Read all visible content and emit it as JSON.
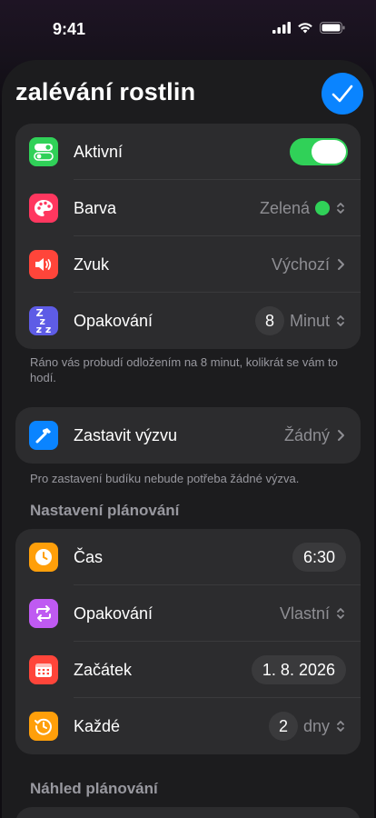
{
  "status": {
    "time": "9:41"
  },
  "header": {
    "title": "zalévání rostlin"
  },
  "card1": {
    "active_label": "Aktivní",
    "active_on": true,
    "color_label": "Barva",
    "color_value": "Zelená",
    "color_hex": "#30d158",
    "sound_label": "Zvuk",
    "sound_value": "Výchozí",
    "repeat_label": "Opakování",
    "repeat_count": "8",
    "repeat_unit": "Minut"
  },
  "card1_note": "Ráno vás probudí odložením na 8 minut, kolikrát se vám to hodí.",
  "card2": {
    "stop_label": "Zastavit výzvu",
    "stop_value": "Žádný"
  },
  "card2_note": "Pro zastavení budíku nebude potřeba žádné výzva.",
  "scheduling": {
    "section_title": "Nastavení plánování",
    "time_label": "Čas",
    "time_value": "6:30",
    "repeat_label": "Opakování",
    "repeat_value": "Vlastní",
    "start_label": "Začátek",
    "start_value": "1. 8. 2026",
    "every_label": "Každé",
    "every_count": "2",
    "every_unit": "dny"
  },
  "preview": {
    "section_title": "Náhled plánování"
  }
}
